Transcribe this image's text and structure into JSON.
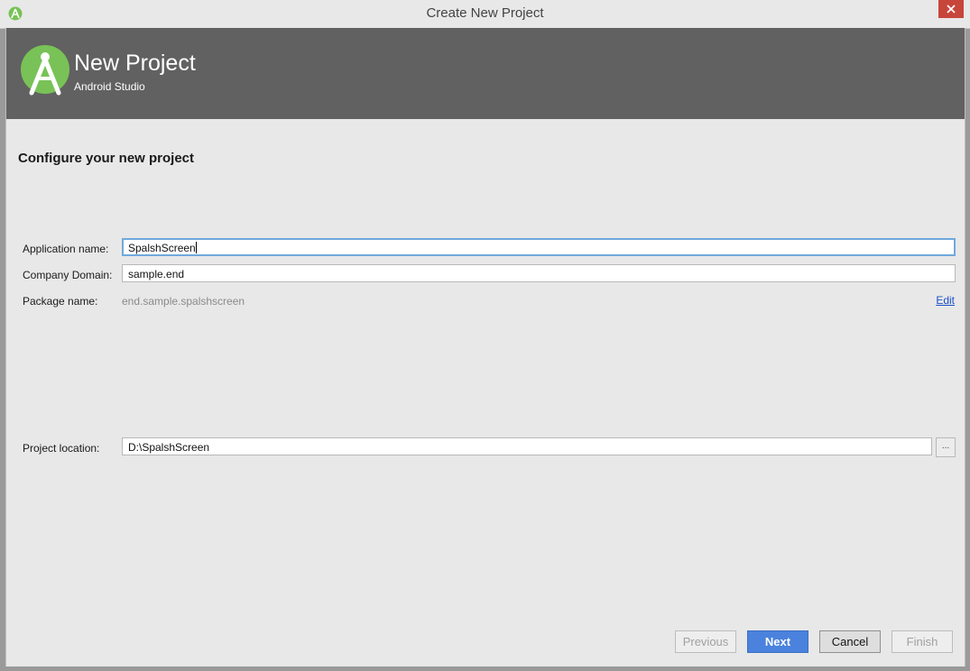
{
  "window": {
    "title": "Create New Project",
    "close_icon": "close-icon",
    "app_icon": "android-studio-icon"
  },
  "banner": {
    "title": "New Project",
    "subtitle": "Android Studio",
    "logo_icon": "android-studio-logo"
  },
  "page": {
    "heading": "Configure your new project"
  },
  "form": {
    "application_name": {
      "label": "Application name:",
      "value": "SpalshScreen"
    },
    "company_domain": {
      "label": "Company Domain:",
      "value": "sample.end"
    },
    "package_name": {
      "label": "Package name:",
      "value": "end.sample.spalshscreen",
      "edit_label": "Edit"
    },
    "project_location": {
      "label": "Project location:",
      "value": "D:\\SpalshScreen",
      "browse_label": "..."
    }
  },
  "footer": {
    "previous": "Previous",
    "next": "Next",
    "cancel": "Cancel",
    "finish": "Finish"
  },
  "colors": {
    "banner_bg": "#616161",
    "primary_button": "#4a82dd",
    "android_green": "#a4c639",
    "close_button": "#c7453a"
  }
}
